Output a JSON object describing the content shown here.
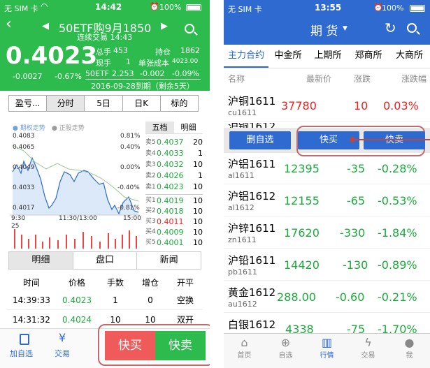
{
  "left": {
    "status": {
      "carrier": "无 SIM 卡",
      "time": "14:42",
      "battery": "100%"
    },
    "header": {
      "title": "50ETF购9月1850",
      "subtitle": "连续交易 14:43",
      "price": "0.4023",
      "change": "-0.0027",
      "change_pct": "-0.67%",
      "stats": [
        {
          "k": "总手",
          "v": "453"
        },
        {
          "k": "持仓",
          "v": "1862"
        },
        {
          "k": "现手",
          "v": "1"
        },
        {
          "k": "单张成本",
          "v": "4023.00"
        }
      ],
      "underlying": {
        "name": "50ETF",
        "price": "2.253",
        "change": "-0.002",
        "pct": "-0.09%"
      },
      "expiry": "2016-09-28到期（剩余5天）"
    },
    "period_tabs": [
      "盈亏...",
      "分时",
      "5日",
      "日K",
      "标的"
    ],
    "chart": {
      "legend": [
        "期权走势",
        "正股走势"
      ],
      "y_left": [
        "0.4083",
        "0.4065",
        "0.4049",
        "0.4033",
        "0.4017"
      ],
      "y_right": [
        "0.81%",
        "0.40%",
        "0.00%",
        "-0.40%",
        "-0.81%"
      ],
      "x": [
        "9:30",
        "11:30/13:00",
        "15:00"
      ],
      "vol_max": "25"
    },
    "book_tabs": [
      "五档",
      "明细"
    ],
    "asks": [
      {
        "l": "卖5",
        "p": "0.4037",
        "v": "20"
      },
      {
        "l": "卖4",
        "p": "0.4033",
        "v": "1"
      },
      {
        "l": "卖3",
        "p": "0.4032",
        "v": "10"
      },
      {
        "l": "卖2",
        "p": "0.4026",
        "v": "1"
      },
      {
        "l": "卖1",
        "p": "0.4023",
        "v": "10"
      }
    ],
    "bids": [
      {
        "l": "买1",
        "p": "0.4019",
        "v": "10"
      },
      {
        "l": "买2",
        "p": "0.4018",
        "v": "10"
      },
      {
        "l": "买3",
        "p": "0.4011",
        "v": "10"
      },
      {
        "l": "买4",
        "p": "0.4009",
        "v": "10"
      },
      {
        "l": "买5",
        "p": "0.4001",
        "v": "10"
      }
    ],
    "detail_tabs": [
      "明细",
      "盘口",
      "新闻"
    ],
    "table": {
      "headers": [
        "时间",
        "价格",
        "手数",
        "增仓",
        "开平"
      ],
      "rows": [
        [
          "14:39:33",
          "0.4023",
          "1",
          "0",
          "空换"
        ],
        [
          "14:31:32",
          "0.4024",
          "10",
          "10",
          "双开"
        ]
      ]
    },
    "bottom": {
      "add_watch": "加自选",
      "trade": "交易",
      "quick_buy": "快买",
      "quick_sell": "快卖"
    }
  },
  "right": {
    "status": {
      "carrier": "无 SIM 卡",
      "time": "13:55",
      "battery": "100%"
    },
    "header": {
      "title": "期 货"
    },
    "tabs": [
      "主力合约",
      "中金所",
      "上期所",
      "郑商所",
      "大商所"
    ],
    "columns": [
      "名称",
      "最新价",
      "涨跌",
      "涨跌幅"
    ],
    "quotes": [
      {
        "name": "沪铜1611",
        "code": "cu1611",
        "price": "37780",
        "chg": "10",
        "pct": "0.03%"
      },
      {
        "name": "沪铝1611",
        "code": "al1611",
        "price": "12395",
        "chg": "-35",
        "pct": "-0.28%"
      },
      {
        "name": "沪铝1612",
        "code": "al1612",
        "price": "12155",
        "chg": "-65",
        "pct": "-0.53%"
      },
      {
        "name": "沪锌1611",
        "code": "zn1611",
        "price": "17620",
        "chg": "-330",
        "pct": "-1.84%"
      },
      {
        "name": "沪铅1611",
        "code": "pb1611",
        "price": "14420",
        "chg": "-130",
        "pct": "-0.89%"
      },
      {
        "name": "黄金1612",
        "code": "au1612",
        "price": "288.00",
        "chg": "-0.60",
        "pct": "-0.21%"
      },
      {
        "name": "白银1612",
        "code": "",
        "price": "4338",
        "chg": "-75",
        "pct": "-1.70%"
      }
    ],
    "partial_name": "沪铜1612",
    "actions": {
      "remove": "删自选",
      "buy": "快买",
      "sell": "快卖"
    },
    "nav": [
      "首页",
      "自选",
      "行情",
      "交易",
      "我"
    ]
  },
  "colors": {
    "green": "#2dbb4e",
    "blue": "#2e6ad0",
    "red": "#e22",
    "up_green": "#1aab3a"
  }
}
